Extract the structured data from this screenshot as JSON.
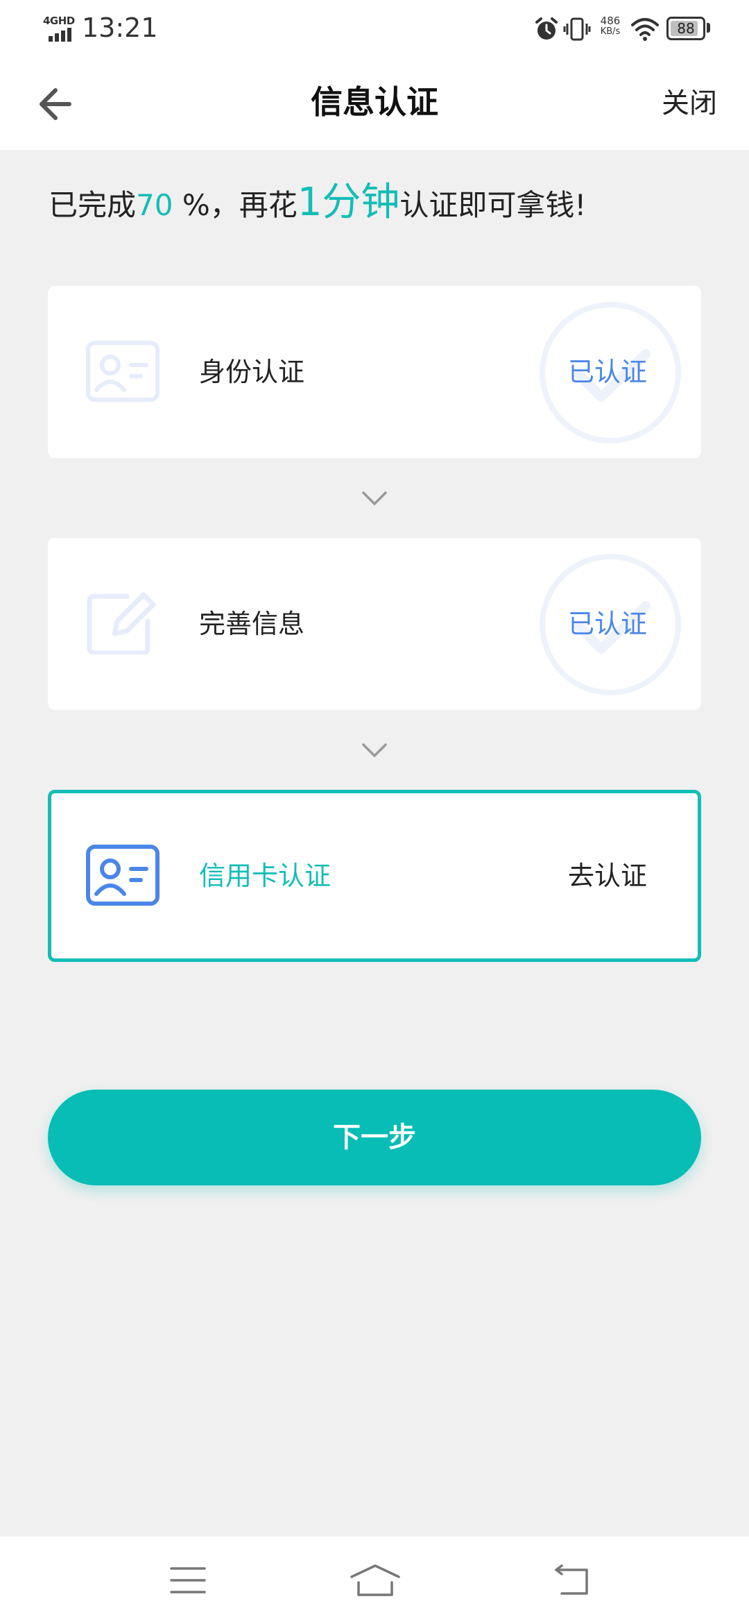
{
  "status_bar": {
    "network": "4GHD",
    "time": "13:21",
    "speed_value": "486",
    "speed_unit": "KB/s",
    "battery": "88",
    "battery_level": 0.88,
    "icons": [
      "signal-icon",
      "alarm-icon",
      "vibrate-icon",
      "wifi-icon",
      "battery-icon"
    ]
  },
  "nav": {
    "title": "信息认证",
    "close_label": "关闭",
    "back_icon": "arrow-left-icon"
  },
  "progress": {
    "prefix": "已完成",
    "percent": "70",
    "percent_suffix": " %，再花",
    "duration": "1分钟",
    "suffix": "认证即可拿钱!"
  },
  "steps": [
    {
      "label": "身份认证",
      "status": "已认证",
      "icon": "id-card-icon",
      "verified": true
    },
    {
      "label": "完善信息",
      "status": "已认证",
      "icon": "edit-icon",
      "verified": true
    },
    {
      "label": "信用卡认证",
      "status": "去认证",
      "icon": "id-card-icon",
      "verified": false
    }
  ],
  "next_button": {
    "label": "下一步"
  },
  "system_nav": {
    "icons": [
      "menu-icon",
      "home-icon",
      "back-icon"
    ]
  },
  "colors": {
    "accent": "#13bdb6",
    "button": "#07bdb5",
    "verified_text": "#4a86e8",
    "icon_faded": "#e6ecfb",
    "icon_active": "#4a86e8",
    "background": "#f0f0f0"
  }
}
